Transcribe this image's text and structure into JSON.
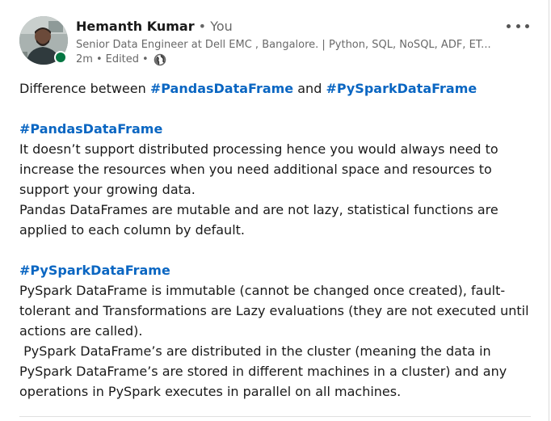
{
  "author": {
    "name": "Hemanth Kumar",
    "separator": "•",
    "relation": "You",
    "headline": "Senior Data Engineer at Dell EMC , Bangalore. | Python, SQL, NoSQL, ADF, ET...",
    "time": "2m",
    "edited": "Edited",
    "visibility_icon": "globe-icon",
    "presence_status": "online",
    "presence_color": "#057642"
  },
  "more_icon": "ellipsis-horizontal-icon",
  "colors": {
    "hashtag": "#0a66c2"
  },
  "post": {
    "intro_prefix": "Difference between ",
    "intro_tag_1": "#PandasDataFrame",
    "intro_mid": " and ",
    "intro_tag_2": "#PySparkDataFrame",
    "pandas_heading": "#PandasDataFrame",
    "pandas_p1": "It doesn’t support distributed processing hence you would always need to increase the resources when you need additional space and resources to support your growing data.",
    "pandas_p2": "Pandas DataFrames are mutable and are not lazy, statistical functions are applied to each column by default.",
    "pyspark_heading": "#PySparkDataFrame",
    "pyspark_p1": "PySpark DataFrame is immutable (cannot be changed once created), fault-tolerant and Transformations are Lazy evaluations (they are not executed until actions are called).",
    "pyspark_p2": " PySpark DataFrame’s are distributed in the cluster (meaning the data in PySpark DataFrame’s are stored in different machines in a cluster) and any operations in PySpark executes in parallel on all machines."
  }
}
